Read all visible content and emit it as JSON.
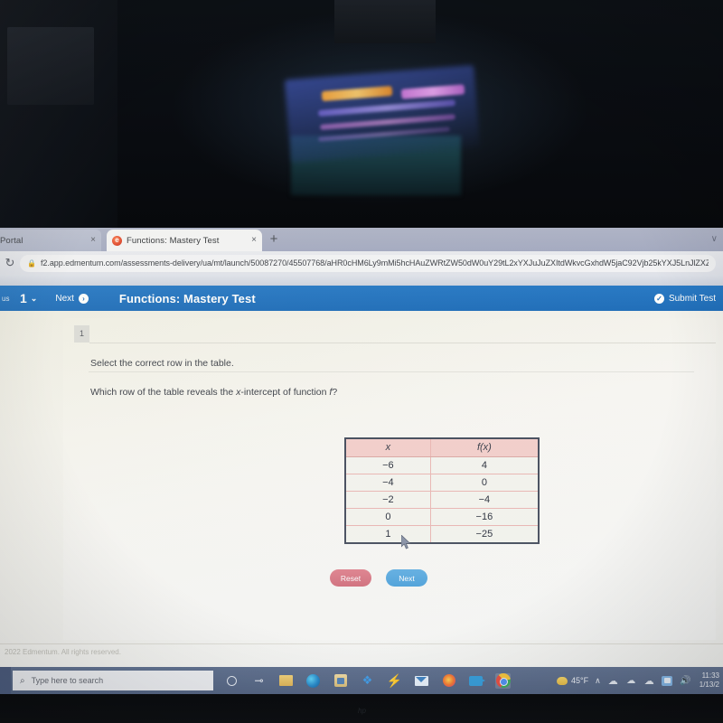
{
  "browser": {
    "tabs": [
      {
        "label": "Portal",
        "favicon": "none",
        "active": false,
        "close_label": "×"
      },
      {
        "label": "Functions: Mastery Test",
        "favicon": "edmentum-e-icon",
        "active": true,
        "close_label": "×"
      }
    ],
    "new_tab_label": "+",
    "tabstrip_chevron": "∨",
    "reload_icon": "↻",
    "lock_icon": "🔒",
    "url": "f2.app.edmentum.com/assessments-delivery/ua/mt/launch/50087270/45507768/aHR0cHM6Ly9mMi5hcHAuZWRtZW50dW0uY29tL2xYXJuJuZXItdWkvcGxhdW5jaC92Vjb25kYXJ5LnJlZXZZXItY2..."
  },
  "app_toolbar": {
    "status_fragment": "us",
    "question_number": "1",
    "question_chevron": "⌄",
    "next_label": "Next",
    "next_icon": "chevron-right-circle-icon",
    "next_icon_glyph": "›",
    "title": "Functions: Mastery Test",
    "submit_label": "Submit Test",
    "submit_icon": "check-circle-icon",
    "submit_icon_glyph": "✓",
    "accent_color": "#1668b8"
  },
  "question": {
    "badge_number": "1",
    "instruction": "Select the correct row in the table.",
    "prompt_prefix": "Which row of the table reveals the ",
    "prompt_italic_1": "x",
    "prompt_middle": "-intercept of function ",
    "prompt_italic_2": "f",
    "prompt_suffix": "?"
  },
  "table": {
    "headers": [
      "x",
      "f(x)"
    ],
    "rows": [
      [
        "−6",
        "4"
      ],
      [
        "−4",
        "0"
      ],
      [
        "−2",
        "−4"
      ],
      [
        "0",
        "−16"
      ],
      [
        "1",
        "−25"
      ]
    ],
    "header_bg": "#f2cfcb",
    "border_color": "#4a5160",
    "divider_color": "#eab8b4"
  },
  "actions": {
    "reset_label": "Reset",
    "next_label": "Next",
    "reset_color": "#d2707d",
    "next_color": "#4fa2da"
  },
  "footer": {
    "copyright": "2022 Edmentum. All rights reserved."
  },
  "taskbar": {
    "search_placeholder": "Type here to search",
    "search_icon": "magnifier-icon",
    "search_icon_glyph": "⌕",
    "icons": [
      {
        "name": "cortana-icon",
        "glyph": ""
      },
      {
        "name": "task-view-icon",
        "glyph": "⌸"
      },
      {
        "name": "file-explorer-icon",
        "glyph": ""
      },
      {
        "name": "microsoft-edge-icon",
        "glyph": ""
      },
      {
        "name": "microsoft-store-icon",
        "glyph": ""
      },
      {
        "name": "dropbox-icon",
        "glyph": "❖"
      },
      {
        "name": "lightning-app-icon",
        "glyph": "⚡"
      },
      {
        "name": "mail-icon",
        "glyph": ""
      },
      {
        "name": "firefox-icon",
        "glyph": ""
      },
      {
        "name": "video-call-icon",
        "glyph": ""
      },
      {
        "name": "google-chrome-icon",
        "glyph": ""
      }
    ],
    "tray": {
      "weather_temp": "45°F",
      "weather_icon": "sun-icon",
      "overflow_chevron": "∧",
      "onedrive_glyph": "☁",
      "cloud_glyph": "☁",
      "network_icon": "network-icon",
      "volume_glyph": "🔊",
      "time": "11:33",
      "date": "1/13/2"
    }
  },
  "monitor": {
    "bezel_logo": "hp"
  }
}
